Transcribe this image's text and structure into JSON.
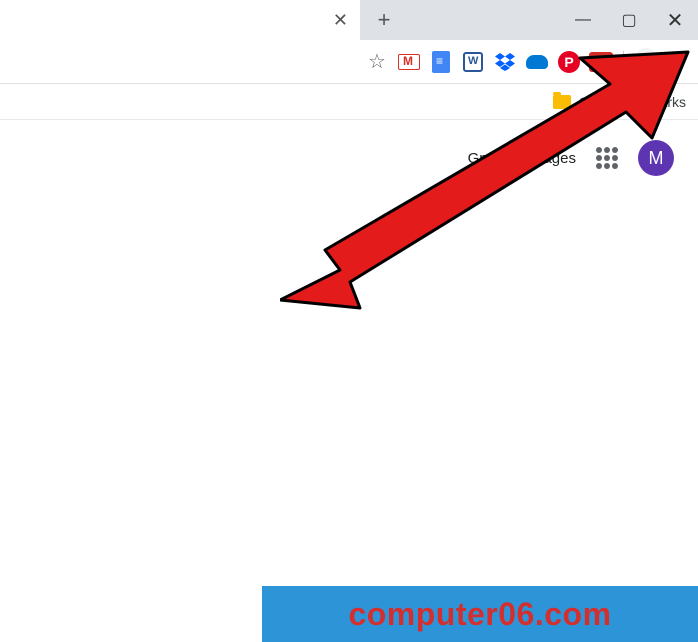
{
  "tab": {
    "close_glyph": "✕"
  },
  "newtab_glyph": "+",
  "window_controls": {
    "minimize": "—",
    "maximize": "▢",
    "close": "✕"
  },
  "toolbar": {
    "star": "☆",
    "extensions": {
      "pinterest_letter": "P",
      "lastpass_dots": "•••"
    }
  },
  "bookmarks": {
    "other_label": "Other bookmarks"
  },
  "content": {
    "gmail": "Gmail",
    "images": "Images",
    "avatar_letter": "M"
  },
  "watermark": "computer06.com"
}
